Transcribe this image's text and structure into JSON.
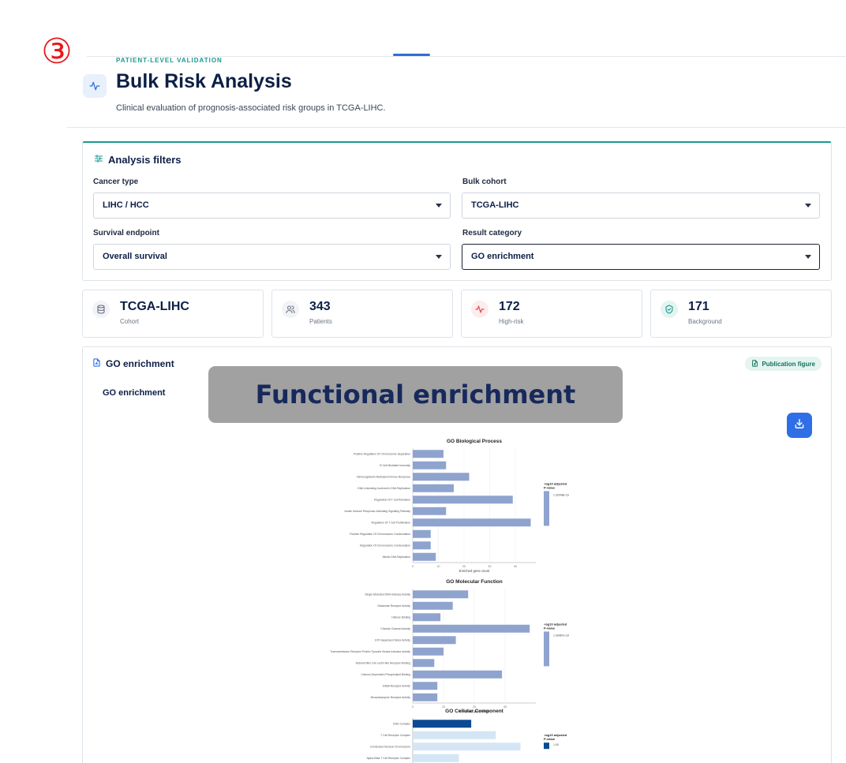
{
  "step_marker": "③",
  "header": {
    "kicker": "PATIENT-LEVEL VALIDATION",
    "title": "Bulk Risk Analysis",
    "subtitle": "Clinical evaluation of prognosis-associated risk groups in TCGA-LIHC."
  },
  "filters": {
    "title": "Analysis filters",
    "cancer_type": {
      "label": "Cancer type",
      "value": "LIHC / HCC"
    },
    "bulk_cohort": {
      "label": "Bulk cohort",
      "value": "TCGA-LIHC"
    },
    "survival_endpoint": {
      "label": "Survival endpoint",
      "value": "Overall survival"
    },
    "result_category": {
      "label": "Result category",
      "value": "GO enrichment"
    }
  },
  "stats": [
    {
      "value": "TCGA-LIHC",
      "label": "Cohort",
      "icon": "database-icon",
      "color": "#6b7483"
    },
    {
      "value": "343",
      "label": "Patients",
      "icon": "users-icon",
      "color": "#6b7483"
    },
    {
      "value": "172",
      "label": "High-risk",
      "icon": "activity-icon",
      "color": "#e5484d"
    },
    {
      "value": "171",
      "label": "Background",
      "icon": "shield-check-icon",
      "color": "#1a9a8f"
    }
  ],
  "panel": {
    "title": "GO enrichment",
    "badge": "Publication figure",
    "subtitle": "GO enrichment",
    "overlay": "Functional enrichment"
  },
  "colors": {
    "accent": "#1a9a8f",
    "brand_blue": "#2e6fe8",
    "bar": "#8fa3cf",
    "cc_dark": "#0b4a93",
    "cc_light": "#d4e6f6"
  },
  "chart_data": [
    {
      "type": "bar",
      "orientation": "horizontal",
      "title": "GO Biological Process",
      "xlabel": "Enriched gene count",
      "categories": [
        "Positive Regulation Of Chromosome Separation",
        "B Cell Mediated Immunity",
        "Immunoglobulin Mediated Immune Response",
        "DNA Unwinding Involved In DNA Replication",
        "Regulation Of T Cell Activation",
        "Innate Immune Response-Activating Signaling Pathway",
        "Regulation Of T Cell Proliferation",
        "Positive Regulation Of Chromosome Condensation",
        "Regulation Of Chromosome Condensation",
        "Mitotic DNA Replication"
      ],
      "values": [
        12,
        13,
        22,
        16,
        39,
        13,
        46,
        7,
        7,
        9
      ],
      "xticks": [
        0,
        10,
        20,
        30,
        40
      ],
      "xlim": [
        0,
        48
      ],
      "legend": {
        "title": "-log10 adjusted P-value",
        "label": "1.32048e-16"
      }
    },
    {
      "type": "bar",
      "orientation": "horizontal",
      "title": "GO Molecular Function",
      "xlabel": "Enriched gene count",
      "categories": [
        "Single-Stranded DNA Helicase Activity",
        "Glutamate Receptor Activity",
        "Histone Binding",
        "Chloride Channel Activity",
        "GTP-dependent Motor Activity",
        "Transmembrane Receptor Protein Tyrosine Kinase Activator Activity",
        "Natural Killer Cell Lectin-like Receptor Binding",
        "Calcium-Dependent Phospholipid Binding",
        "GABA Receptor Activity",
        "Benzodiazepine Receptor Activity"
      ],
      "values": [
        18,
        13,
        9,
        38,
        14,
        10,
        7,
        29,
        8,
        8
      ],
      "xticks": [
        0,
        10,
        20,
        30
      ],
      "xlim": [
        0,
        40
      ],
      "legend": {
        "title": "-log10 adjusted P-value",
        "label": "1.09987e-18"
      }
    },
    {
      "type": "bar",
      "orientation": "horizontal",
      "title": "GO Cellular Component",
      "xlabel": "",
      "categories": [
        "CMG Complex",
        "T Cell Receptor Complex",
        "Condensed Nuclear Chromosome",
        "Alpha-Beta T Cell Receptor Complex",
        ""
      ],
      "values": [
        19,
        27,
        35,
        15,
        19
      ],
      "xlim": [
        0,
        40
      ],
      "legend": {
        "title": "-log10 adjusted P-value",
        "label": "1.00"
      }
    }
  ]
}
